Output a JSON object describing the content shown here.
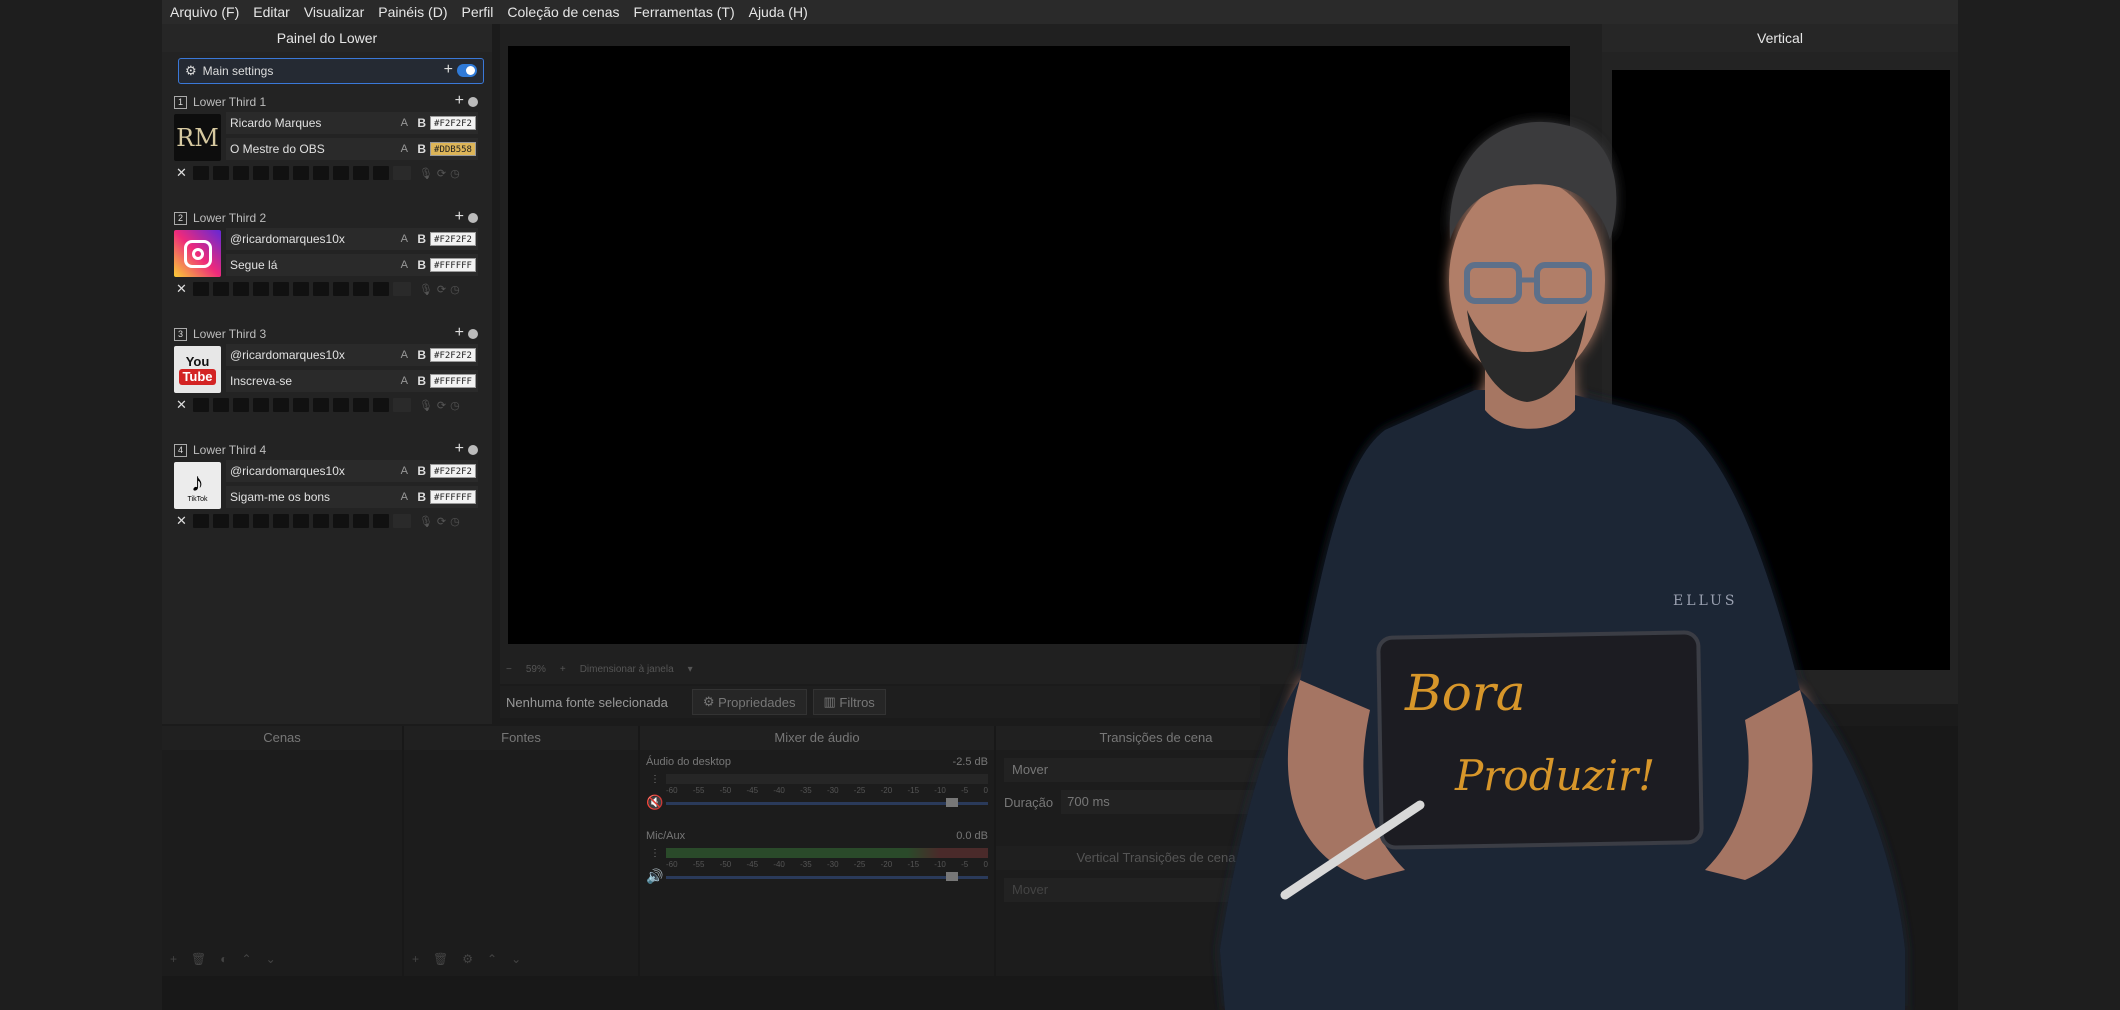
{
  "menu": [
    "Arquivo (F)",
    "Editar",
    "Visualizar",
    "Painéis (D)",
    "Perfil",
    "Coleção de cenas",
    "Ferramentas (T)",
    "Ajuda (H)"
  ],
  "lower_panel": {
    "title": "Painel do Lower",
    "main_settings": "Main settings",
    "lower_thirds": [
      {
        "num": "1",
        "title": "Lower Third 1",
        "line1": "Ricardo Marques",
        "color1": "#F2F2F2",
        "line2": "O Mestre do OBS",
        "color2": "#DDB558",
        "thumb": "rm-logo"
      },
      {
        "num": "2",
        "title": "Lower Third 2",
        "line1": "@ricardomarques10x",
        "color1": "#F2F2F2",
        "line2": "Segue lá",
        "color2": "#FFFFFF",
        "thumb": "instagram-logo"
      },
      {
        "num": "3",
        "title": "Lower Third 3",
        "line1": "@ricardomarques10x",
        "color1": "#F2F2F2",
        "line2": "Inscreva-se",
        "color2": "#FFFFFF",
        "thumb": "youtube-logo"
      },
      {
        "num": "4",
        "title": "Lower Third 4",
        "line1": "@ricardomarques10x",
        "color1": "#F2F2F2",
        "line2": "Sigam-me os bons",
        "color2": "#FFFFFF",
        "thumb": "tiktok-logo"
      }
    ]
  },
  "preview": {
    "zoom": "59%",
    "zoom_mode": "Dimensionar à janela"
  },
  "vertical": {
    "title": "Vertical"
  },
  "source_bar": {
    "status": "Nenhuma fonte selecionada",
    "properties": "Propriedades",
    "filters": "Filtros"
  },
  "docks": {
    "scenes": "Cenas",
    "sources": "Fontes",
    "mixer": "Mixer de áudio",
    "transitions": "Transições de cena",
    "vertical_transitions": "Vertical Transições de cena"
  },
  "mixer": {
    "channels": [
      {
        "name": "Áudio do desktop",
        "db": "-2.5 dB",
        "muted": true
      },
      {
        "name": "Mic/Aux",
        "db": "0.0 dB",
        "muted": false
      }
    ],
    "scale": [
      "-60",
      "-55",
      "-50",
      "-45",
      "-40",
      "-35",
      "-30",
      "-25",
      "-20",
      "-15",
      "-10",
      "-5",
      "0"
    ]
  },
  "transitions": {
    "selected": "Mover",
    "duration_label": "Duração",
    "duration_value": "700 ms",
    "vertical_selected": "Mover"
  },
  "overlay": {
    "tablet_text_1": "Bora",
    "tablet_text_2": "Produzir!",
    "shirt_brand": "ELLUS"
  }
}
